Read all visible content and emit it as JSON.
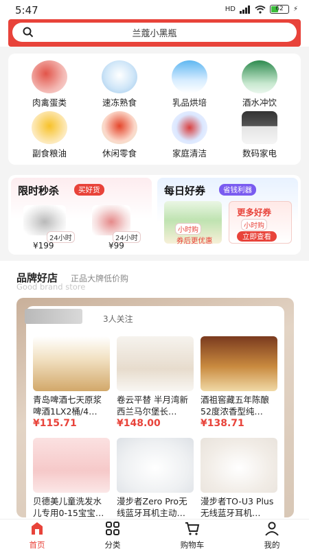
{
  "status": {
    "time": "5:47",
    "network": "HD",
    "battery": "62"
  },
  "search": {
    "query": "兰蔻小黑瓶"
  },
  "categories": [
    {
      "label": "肉禽蛋类",
      "color": "#f3b7b2"
    },
    {
      "label": "速冻熟食",
      "color": "#cfe6f8"
    },
    {
      "label": "乳品烘培",
      "color": "#d6ecff"
    },
    {
      "label": "酒水冲饮",
      "color": "#c7e8cf"
    },
    {
      "label": "副食粮油",
      "color": "#fde9b9"
    },
    {
      "label": "休闲零食",
      "color": "#fbd7c9"
    },
    {
      "label": "家庭清洁",
      "color": "#dbe7ff"
    },
    {
      "label": "数码家电",
      "color": "#e4e4e4"
    }
  ],
  "promo": {
    "flash": {
      "title": "限时秒杀",
      "tag": "买好货",
      "items": [
        {
          "hours": "24小时",
          "price": "¥199"
        },
        {
          "hours": "24小时",
          "price": "¥99"
        }
      ]
    },
    "daily": {
      "title": "每日好券",
      "tag": "省钱利器",
      "left_hours": "小时购",
      "left_label": "券后更优惠",
      "right_title": "更多好券",
      "right_hours": "小时购",
      "right_button": "立即查看"
    }
  },
  "brand": {
    "title": "品牌好店",
    "subtitle": "正品大牌低价购",
    "en": "Good brand store",
    "followers": "3人关注",
    "products": [
      {
        "name": "青岛啤酒七天原浆啤酒1LX2桶/4…",
        "price": "¥115.71"
      },
      {
        "name": "卷云平替 半月湾新西兰马尔堡长…",
        "price": "¥148.00"
      },
      {
        "name": "酒祖窖藏五年陈酿52度浓香型纯…",
        "price": "¥138.71"
      },
      {
        "name": "贝德美儿童洗发水儿专用0-15宝宝…",
        "price": ""
      },
      {
        "name": "漫步者Zero Pro无线蓝牙耳机主动…",
        "price": ""
      },
      {
        "name": "漫步者TO-U3 Plus无线蓝牙耳机…",
        "price": ""
      }
    ]
  },
  "tabs": [
    {
      "label": "首页"
    },
    {
      "label": "分类"
    },
    {
      "label": "购物车"
    },
    {
      "label": "我的"
    }
  ]
}
